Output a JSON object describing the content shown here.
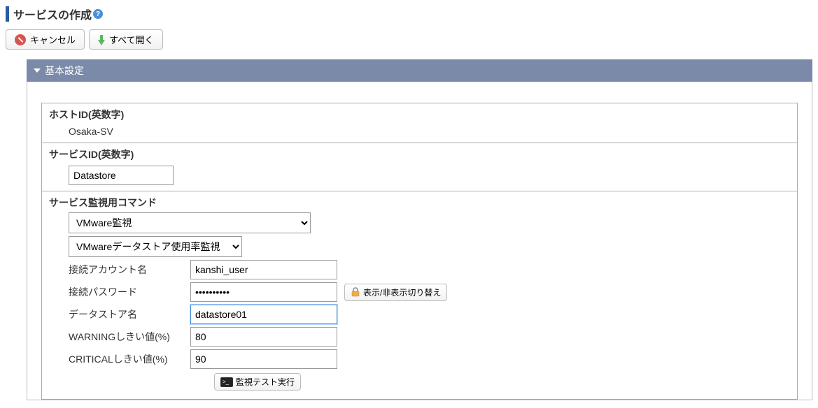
{
  "page": {
    "title": "サービスの作成",
    "help_icon": "?"
  },
  "toolbar": {
    "cancel": "キャンセル",
    "expand_all": "すべて開く"
  },
  "section": {
    "title": "基本設定"
  },
  "fields": {
    "host_id": {
      "label": "ホストID(英数字)",
      "value": "Osaka-SV"
    },
    "service_id": {
      "label": "サービスID(英数字)",
      "value": "Datastore"
    },
    "monitor_command": {
      "label": "サービス監視用コマンド",
      "select1": "VMware監視",
      "select2": "VMwareデータストア使用率監視",
      "account_label": "接続アカウント名",
      "account_value": "kanshi_user",
      "password_label": "接続パスワード",
      "password_value": "••••••••••",
      "toggle_visibility": "表示/非表示切り替え",
      "datastore_label": "データストア名",
      "datastore_value": "datastore01",
      "warning_label": "WARNINGしきい値(%)",
      "warning_value": "80",
      "critical_label": "CRITICALしきい値(%)",
      "critical_value": "90",
      "test_button": "監視テスト実行"
    }
  }
}
